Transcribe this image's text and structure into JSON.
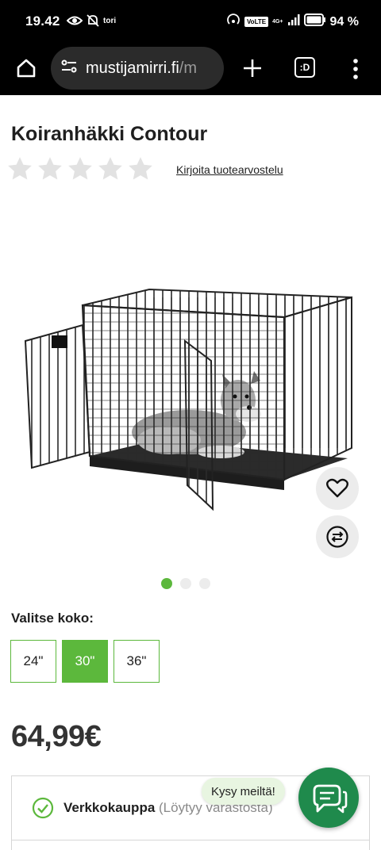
{
  "status_bar": {
    "time": "19.42",
    "carrier_note": "tori",
    "volte": "VoLTE",
    "network": "4G+",
    "battery": "94 %"
  },
  "browser": {
    "url_main": "mustijamirri.fi",
    "url_rest": "/m",
    "tabs_label": ":D"
  },
  "product": {
    "title": "Koiranhäkki Contour",
    "rating_stars": 0,
    "rating_max": 5,
    "review_link": "Kirjoita tuotearvostelu",
    "image_count": 3,
    "active_image": 1
  },
  "size_selector": {
    "label": "Valitse koko:",
    "options": [
      "24\"",
      "30\"",
      "36\""
    ],
    "selected": "30\""
  },
  "price": "64,99€",
  "stock": {
    "channel": "Verkkokauppa",
    "status": "(Löytyy varastosta)"
  },
  "chat": {
    "bubble": "Kysy meiltä!"
  },
  "colors": {
    "accent": "#5cb83c",
    "chat": "#1f8a4c",
    "fab_bg": "#ececec"
  }
}
